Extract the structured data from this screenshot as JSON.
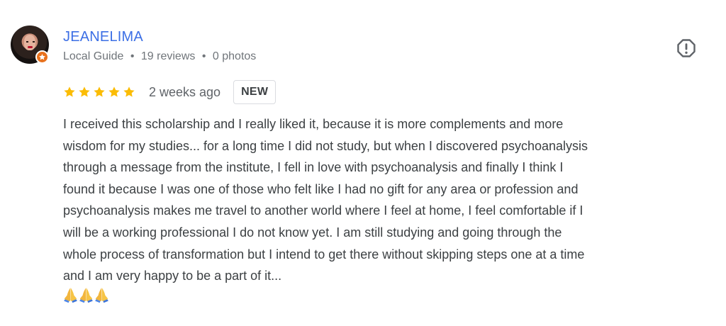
{
  "review": {
    "reviewer": {
      "name": "JEANELIMA",
      "level": "Local Guide",
      "reviews": "19 reviews",
      "photos": "0 photos",
      "separator": "•",
      "avatar_icon": "profile-photo",
      "badge_icon": "local-guide-star-icon",
      "badge_color": "#e8711c"
    },
    "rating": {
      "stars": 5,
      "max_stars": 5,
      "star_color": "#fbbc04"
    },
    "date": "2 weeks ago",
    "badge": "NEW",
    "text": "I received this scholarship and I really liked it, because it is more complements and more\nwisdom for my studies... for a long time I did not study, but when I discovered psychoanalysis\nthrough a message from the institute, I fell in love with psychoanalysis and finally I think I\nfound it because I was one of those who felt like I had no gift for any area or profession and\npsychoanalysis makes me travel to another world where I feel at home, I feel comfortable if I\nwill be a working professional I do not know yet. I am still studying and going through the\nwhole process of transformation but I intend to get there without skipping steps one at a time\nand I am very happy to be a part of it...",
    "emojis": [
      "folded-hands-icon",
      "folded-hands-icon",
      "folded-hands-icon"
    ],
    "actions": {
      "flag_icon": "report-alert-icon"
    },
    "colors": {
      "name": "#3c6fe5",
      "meta": "#70757a",
      "text": "#3c4043"
    }
  }
}
